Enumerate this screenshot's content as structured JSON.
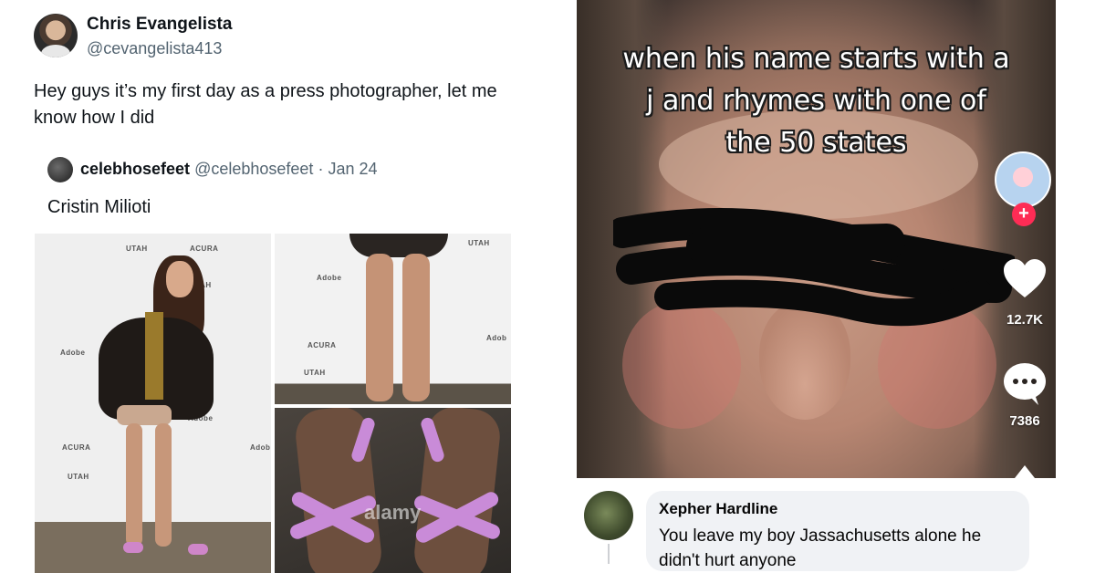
{
  "tweet": {
    "author_name": "Chris Evangelista",
    "author_handle": "@cevangelista413",
    "avatar_icon": "person-avatar",
    "text": "Hey guys it’s my first day as a press photographer, let me know how I did",
    "quote": {
      "author_name": "celebhosefeet",
      "author_handle": "@celebhosefeet",
      "date": "· Jan 24",
      "text": "Cristin Milioti",
      "photos": [
        {
          "wall_logos": [
            "UTAH",
            "ACURA",
            "Adobe",
            "ACURA",
            "UTAH",
            "Adobe",
            "Adob",
            "UTAH"
          ]
        },
        {
          "wall_logos": [
            "UTAH",
            "ACURA",
            "Adobe",
            "UTAH",
            "Adob"
          ]
        },
        {
          "watermark": "alamy"
        }
      ]
    }
  },
  "meme": {
    "caption_lines": [
      "when his name starts with a",
      "j and rhymes with one of",
      "the 50 states"
    ],
    "likes": "12.7K",
    "comments": "7386",
    "icons": [
      "profile-avatar",
      "follow-plus-icon",
      "heart-icon",
      "comment-icon",
      "share-icon"
    ],
    "accent": "#fe2c55"
  },
  "fb_comment": {
    "name": "Xepher Hardline",
    "text": "You leave my boy Jassachusetts alone he didn't hurt anyone"
  }
}
